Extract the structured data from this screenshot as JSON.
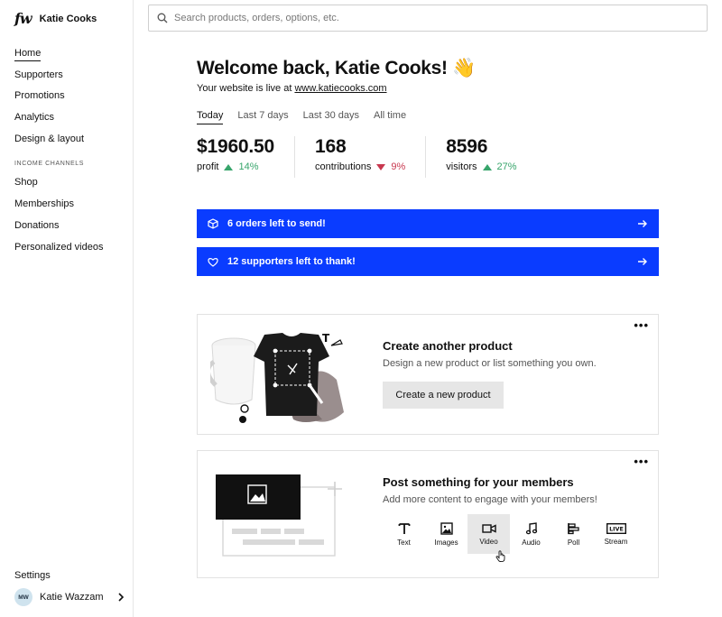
{
  "brand": {
    "logo": "fw",
    "name": "Katie Cooks"
  },
  "sidebar": {
    "items": [
      {
        "label": "Home",
        "active": true
      },
      {
        "label": "Supporters"
      },
      {
        "label": "Promotions"
      },
      {
        "label": "Analytics"
      },
      {
        "label": "Design & layout"
      }
    ],
    "section_label": "INCOME CHANNELS",
    "channels": [
      {
        "label": "Shop"
      },
      {
        "label": "Memberships"
      },
      {
        "label": "Donations"
      },
      {
        "label": "Personalized videos"
      }
    ],
    "settings_label": "Settings",
    "user": {
      "initials": "MW",
      "name": "Katie Wazzam"
    }
  },
  "search": {
    "placeholder": "Search products, orders, options, etc.",
    "value": ""
  },
  "main": {
    "welcome": "Welcome back, Katie Cooks! 👋",
    "live_prefix": "Your website is live at ",
    "live_url": "www.katiecooks.com",
    "tabs": [
      {
        "label": "Today",
        "active": true
      },
      {
        "label": "Last 7 days"
      },
      {
        "label": "Last 30 days"
      },
      {
        "label": "All time"
      }
    ],
    "stats": [
      {
        "value": "$1960.50",
        "label": "profit",
        "change": "14%",
        "direction": "up"
      },
      {
        "value": "168",
        "label": "contributions",
        "change": "9%",
        "direction": "down"
      },
      {
        "value": "8596",
        "label": "visitors",
        "change": "27%",
        "direction": "up"
      }
    ]
  },
  "banners": [
    {
      "icon": "box-icon",
      "text": "6 orders left to send!"
    },
    {
      "icon": "heart-icon",
      "text": "12 supporters left to thank!"
    }
  ],
  "product_card": {
    "title": "Create another product",
    "subtitle": "Design a new product or list something you own.",
    "button": "Create a new product",
    "menu": "•••"
  },
  "post_card": {
    "title": "Post something for your members",
    "subtitle": "Add more content to engage with your members!",
    "menu": "•••",
    "types": [
      {
        "label": "Text",
        "icon": "text-icon"
      },
      {
        "label": "Images",
        "icon": "image-icon"
      },
      {
        "label": "Video",
        "icon": "video-icon",
        "hover": true
      },
      {
        "label": "Audio",
        "icon": "music-icon"
      },
      {
        "label": "Poll",
        "icon": "poll-icon"
      },
      {
        "label": "Stream",
        "icon": "live-icon",
        "badge": "LIVE"
      }
    ]
  },
  "colors": {
    "accent": "#0a3cff",
    "up": "#37a56b",
    "down": "#c8384f"
  }
}
